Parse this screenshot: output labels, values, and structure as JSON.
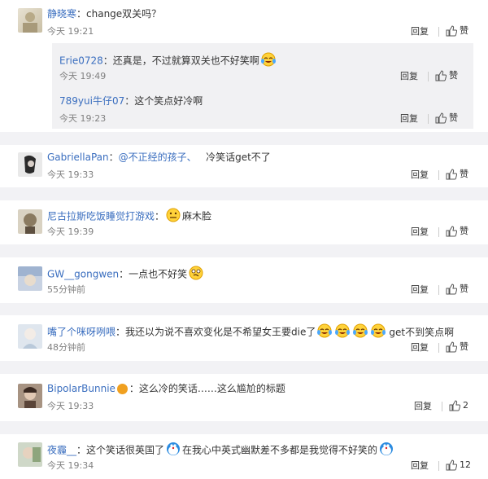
{
  "comments": [
    {
      "user": "静晓寒",
      "text": "：change双关吗？",
      "time": "今天 19:21",
      "reply_label": "回复",
      "like_label": "赞",
      "replies": [
        {
          "user": "Erie0728",
          "text": "：还真是，不过就算双关也不好笑啊",
          "time": "今天 19:49",
          "reply_label": "回复",
          "like_label": "赞"
        },
        {
          "user": "789yui牛仔07",
          "text": "：这个笑点好冷啊",
          "time": "今天 19:23",
          "reply_label": "回复",
          "like_label": "赞"
        }
      ]
    },
    {
      "user": "GabriellaPan",
      "text_a": "：",
      "mention": "@不正经的孩子、",
      "text_b": "   冷笑话get不了",
      "time": "今天 19:33",
      "reply_label": "回复",
      "like_label": "赞"
    },
    {
      "user": "尼古拉斯吃饭睡觉打游戏",
      "text_a": "：",
      "text_b": "麻木脸",
      "time": "今天 19:39",
      "reply_label": "回复",
      "like_label": "赞"
    },
    {
      "user": "GW__gongwen",
      "text": "：一点也不好笑",
      "time": "55分钟前",
      "reply_label": "回复",
      "like_label": "赞"
    },
    {
      "user": "嘴了个咪呀咧喂",
      "text": "：我还以为说不喜欢变化是不希望女王要die了",
      "text_b": "get不到笑点啊",
      "time": "48分钟前",
      "reply_label": "回复",
      "like_label": "赞"
    },
    {
      "user": "BipolarBunnie",
      "text": "：这么冷的笑话……这么尴尬的标题",
      "time": "今天 19:33",
      "reply_label": "回复",
      "like_count": "2"
    },
    {
      "user": "夜霾__",
      "text_a": "：这个笑话很英国了",
      "text_b": "在我心中英式幽默差不多都是我觉得不好笑的",
      "time": "今天 19:34",
      "reply_label": "回复",
      "like_count": "12"
    }
  ],
  "colors": {
    "username": "#3a6ebf",
    "background": "#f2f2f5",
    "subbox": "#f1f1f3",
    "time": "#808080"
  }
}
